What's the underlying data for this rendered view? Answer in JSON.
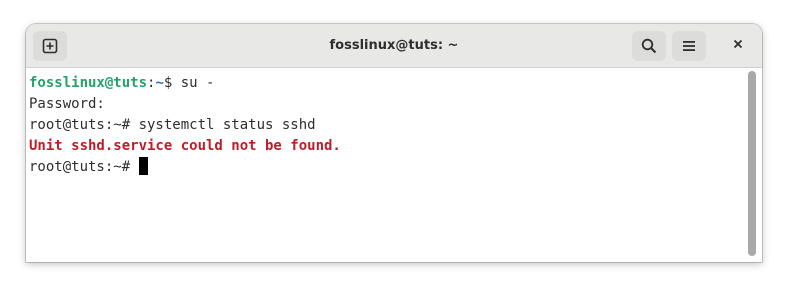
{
  "window": {
    "title": "fosslinux@tuts: ~"
  },
  "headerbar": {
    "new_tab_icon": "new-tab-plus-icon",
    "search_icon": "search-icon",
    "menu_icon": "hamburger-menu-icon",
    "close_icon": "close-icon",
    "close_glyph": "×"
  },
  "terminal": {
    "lines": [
      {
        "user_host": "fosslinux@tuts",
        "sep": ":",
        "path": "~",
        "rest": "$ su -"
      },
      {
        "text": "Password:"
      },
      {
        "text": "root@tuts:~# systemctl status sshd"
      },
      {
        "error": "Unit sshd.service could not be found."
      },
      {
        "prompt": "root@tuts:~# "
      }
    ]
  },
  "colors": {
    "headerbar_bg": "#e8e8e7",
    "user_green": "#26a269",
    "path_blue": "#1c71d8",
    "error_red": "#c01c28",
    "text": "#2e2e2e"
  }
}
